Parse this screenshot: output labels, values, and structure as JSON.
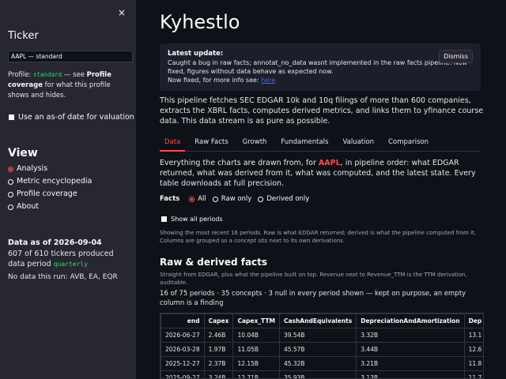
{
  "sidebar": {
    "close_glyph": "×",
    "ticker_label": "Ticker",
    "ticker_value": "AAPL — standard",
    "profile_prefix": "Profile:",
    "profile_code": "standard",
    "profile_mid": "— see",
    "profile_link": "Profile coverage",
    "profile_suffix": "for what this profile shows and hides.",
    "asof_label": "Use an as-of date for valuation",
    "view_title": "View",
    "view_options": [
      "Analysis",
      "Metric encyclopedia",
      "Profile coverage",
      "About"
    ],
    "view_selected": 0,
    "data_as_of": "Data as of 2026-09-04",
    "tickers_text": "607 of 610 tickers produced data period",
    "period_code": "quarterly",
    "no_data_text": "No data this run: AVB, EA, EQR"
  },
  "main": {
    "title": "Kyhestlo",
    "alert": {
      "heading": "Latest update:",
      "line1": "Caught a bug in raw facts; annotat_no_data wasnt implemented in the raw facts pipeline. Now fixed, figures without data behave as expected now.",
      "line2_prefix": "Now fixed, for more info see:",
      "link_text": "here",
      "dismiss_label": "Dismiss"
    },
    "intro": "This pipeline fetches SEC EDGAR 10k and 10q filings of more than 600 companies, extracts the XBRL facts, computes derived metrics, and links them to yfinance course data. This data stream is as pure as possible.",
    "tabs": [
      "Data",
      "Raw Facts",
      "Growth",
      "Fundamentals",
      "Valuation",
      "Comparison"
    ],
    "active_tab": 0,
    "body_prefix": "Everything the charts are drawn from, for",
    "body_ticker": "AAPL",
    "body_suffix": ", in pipeline order: what EDGAR returned, what was derived from it, what was computed, and the latest state. Every table downloads at full precision.",
    "facts_label": "Facts",
    "facts_options": [
      "All",
      "Raw only",
      "Derived only"
    ],
    "facts_selected": 0,
    "show_all_label": "Show all periods",
    "note": "Showing the most recent 16 periods. Raw is what EDGAR returned; derived is what the pipeline computed from it. Columns are grouped so a concept sits next to its own derivations.",
    "section_title": "Raw & derived facts",
    "section_caption": "Straight from EDGAR, plus what the pipeline built on top. Revenue next to Revenue_TTM is the TTM derivation, auditable.",
    "summary": "16 of 75 periods · 35 concepts · 3 null in every period shown — kept on purpose, an empty column is a finding",
    "table": {
      "headers": [
        "end",
        "Capex",
        "Capex_TTM",
        "CashAndEquivalents",
        "DepreciationAndAmortization",
        "Dep"
      ],
      "rows": [
        [
          "2026-06-27",
          "2.46B",
          "10.04B",
          "39.54B",
          "3.32B",
          "13.1"
        ],
        [
          "2026-03-28",
          "1.97B",
          "11.05B",
          "45.57B",
          "3.44B",
          "12.6"
        ],
        [
          "2025-12-27",
          "2.37B",
          "12.15B",
          "45.32B",
          "3.21B",
          "11.8"
        ],
        [
          "2025-09-27",
          "3.24B",
          "12.71B",
          "35.93B",
          "3.13B",
          "11.7"
        ]
      ]
    }
  },
  "colors": {
    "accent": "#ff4b4b",
    "code": "#3dd56d",
    "link": "#3b6cf7",
    "background": "#0e1117",
    "sidebar": "#262730"
  }
}
